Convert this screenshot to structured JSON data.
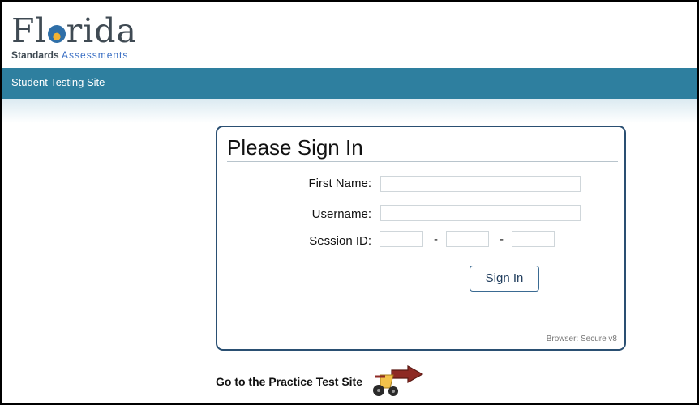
{
  "brand": {
    "logo_text_pre": "Fl",
    "logo_text_post": "rida",
    "subtitle_strong": "Standards",
    "subtitle_accent": "Assessments"
  },
  "topbar": {
    "title": "Student Testing Site"
  },
  "signin": {
    "heading": "Please Sign In",
    "first_name_label": "First Name:",
    "first_name_value": "",
    "username_label": "Username:",
    "username_value": "",
    "session_label": "Session ID:",
    "session_part1": "",
    "session_part2": "",
    "session_part3": "",
    "dash": "-",
    "button_label": "Sign In",
    "browser_info": "Browser: Secure v8"
  },
  "practice": {
    "link_text": "Go to the Practice Test Site",
    "icon": "tricycle-arrow-icon"
  },
  "colors": {
    "topbar": "#2e7f9f",
    "card_border": "#2a4f72",
    "logo_accent": "#3a6fc4"
  }
}
